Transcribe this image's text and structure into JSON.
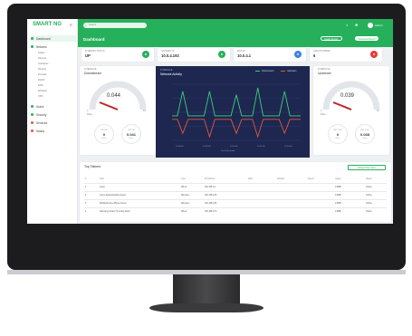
{
  "sidebar": {
    "brand": "SMART NG",
    "items": [
      {
        "label": "Dashboard",
        "active": true
      },
      {
        "label": "Network",
        "active": false
      },
      {
        "label": "Users",
        "active": false
      },
      {
        "label": "Security",
        "active": false
      },
      {
        "label": "Services",
        "active": false
      },
      {
        "label": "Status",
        "active": false
      }
    ],
    "subitems": [
      "Status",
      "Devices",
      "Interfaces",
      "Routing",
      "Firewall",
      "DHCP",
      "DNS",
      "Wireless",
      "VPN"
    ]
  },
  "topbar": {
    "search_placeholder": "Search",
    "user": "Admin",
    "page_title": "Dashboard",
    "pill1": "Health Monitor",
    "pill2": "Download Report"
  },
  "stats": [
    {
      "label": "INTERNET STATUS",
      "value": "UP",
      "color": "#27b05b",
      "icon": "●"
    },
    {
      "label": "GATEWAY IP",
      "value": "10.0.4.192",
      "color": "#27b05b",
      "icon": "●"
    },
    {
      "label": "WAN IP",
      "value": "10.0.4.1",
      "color": "#3a86d9",
      "icon": "●"
    },
    {
      "label": "UNAUTHORIZED",
      "value": "6",
      "color": "#f08a2a",
      "icon": "●"
    },
    {
      "label": "ALERTS",
      "value": "",
      "color": "#e53b3b",
      "icon": "●"
    }
  ],
  "gauges": {
    "left": {
      "label": "INTERFACE",
      "title": "Downstream",
      "value": "0.044",
      "min": "0",
      "max": "50",
      "min_label": "Mbps",
      "fraction": 0.001,
      "mini": [
        {
          "title": "PKT IN",
          "value": "0",
          "sub": "Mbps"
        },
        {
          "title": "PKT IN",
          "value": "0.041",
          "sub": "Mbps"
        }
      ]
    },
    "right": {
      "label": "INTERFACE",
      "title": "Upstream",
      "value": "0.039",
      "min": "0",
      "max": "50",
      "min_label": "Mbps",
      "fraction": 0.001,
      "mini": [
        {
          "title": "PKT OUT",
          "value": "0",
          "sub": "Mbps"
        },
        {
          "title": "PKT OUT",
          "value": "0.038",
          "sub": "Mbps"
        }
      ]
    }
  },
  "activity": {
    "label": "INTERFACE",
    "title": "Network Activity",
    "legend": [
      "Downstream",
      "Upstream"
    ],
    "series_colors": [
      "#3ad17a",
      "#e4573d"
    ],
    "x_labels": [
      "12:00:00",
      "12:05:00",
      "12:10:00",
      "12:15:00",
      "12:20:00"
    ],
    "x_title": "Time (Seconds)"
  },
  "chart_data": {
    "type": "line",
    "title": "Network Activity",
    "series": [
      {
        "name": "Downstream",
        "values": [
          2,
          2,
          9,
          2,
          2,
          2,
          2,
          9,
          2,
          2,
          2,
          2,
          8,
          2,
          2,
          2,
          10,
          2,
          2,
          2,
          2,
          9,
          2,
          2,
          2
        ]
      },
      {
        "name": "Upstream",
        "values": [
          1,
          1,
          -3,
          1,
          1,
          1,
          1,
          -4,
          1,
          1,
          1,
          1,
          -3,
          1,
          1,
          1,
          -4,
          1,
          1,
          1,
          1,
          -3,
          1,
          1,
          1
        ]
      }
    ]
  },
  "talkers": {
    "title": "Top Talkers",
    "button": "Refresh Top Users",
    "columns": [
      "#",
      "Host",
      "Type",
      "IP Address",
      "MAC",
      "Packets",
      "Speed",
      "Usage",
      "Status"
    ],
    "rows": [
      [
        "1",
        "router",
        "Wired",
        "192.168.0.1",
        "",
        "",
        "",
        "0.0MB",
        "Online"
      ],
      [
        "2",
        "User-Laptop-Desktop-Guest",
        "Wireless",
        "192.168.0.25",
        "",
        "",
        "",
        "0.0MB",
        "Online"
      ],
      [
        "3",
        "Mobile-Device-iPhone-Guest",
        "Wireless",
        "192.168.0.54",
        "",
        "",
        "",
        "0.0MB",
        "Online"
      ],
      [
        "4",
        "Samsung-Smart-TV-Living-Room",
        "Wired",
        "192.168.0.74",
        "",
        "",
        "",
        "0.0MB",
        "Online"
      ]
    ]
  }
}
